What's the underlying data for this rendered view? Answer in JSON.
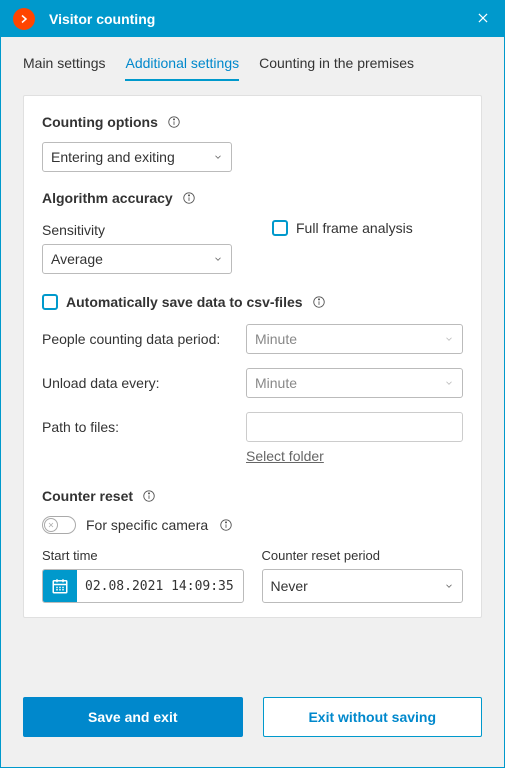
{
  "titlebar": {
    "title": "Visitor counting"
  },
  "tabs": {
    "main": "Main settings",
    "additional": "Additional settings",
    "premises": "Counting in the premises",
    "active": "additional"
  },
  "counting_options": {
    "title": "Counting options",
    "value": "Entering and exiting"
  },
  "algorithm": {
    "title": "Algorithm accuracy",
    "sensitivity_label": "Sensitivity",
    "sensitivity_value": "Average",
    "full_frame_label": "Full frame analysis",
    "full_frame_checked": false
  },
  "autosave": {
    "label": "Automatically save data to csv-files",
    "checked": false,
    "period_label": "People counting data period:",
    "period_value": "Minute",
    "unload_label": "Unload data every:",
    "unload_value": "Minute",
    "path_label": "Path to files:",
    "path_value": "",
    "select_folder": "Select folder"
  },
  "counter_reset": {
    "title": "Counter reset",
    "toggle_label": "For specific camera",
    "toggle_on": false,
    "start_time_label": "Start time",
    "start_time_value": "02.08.2021 14:09:35",
    "period_label": "Counter reset period",
    "period_value": "Never"
  },
  "footer": {
    "save": "Save and exit",
    "exit": "Exit without saving"
  }
}
